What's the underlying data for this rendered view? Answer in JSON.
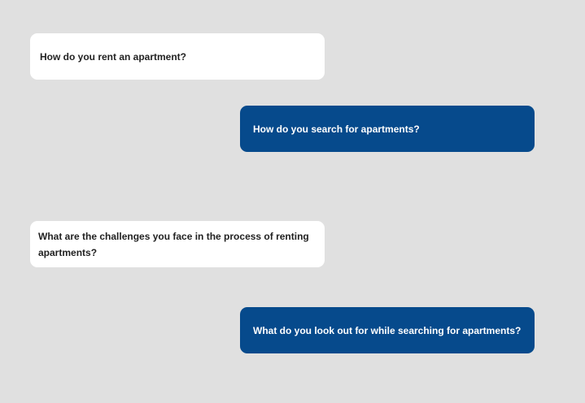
{
  "messages": [
    {
      "side": "incoming",
      "text": "How do you rent an apartment?"
    },
    {
      "side": "outgoing",
      "text": "How do you search for apartments?"
    },
    {
      "side": "incoming",
      "text": "What are the challenges you face in the process of renting apartments?"
    },
    {
      "side": "outgoing",
      "text": "What do you look out for while searching for apartments?"
    }
  ],
  "colors": {
    "background": "#e0e0e0",
    "incoming_bubble": "#ffffff",
    "outgoing_bubble": "#064a8c"
  }
}
